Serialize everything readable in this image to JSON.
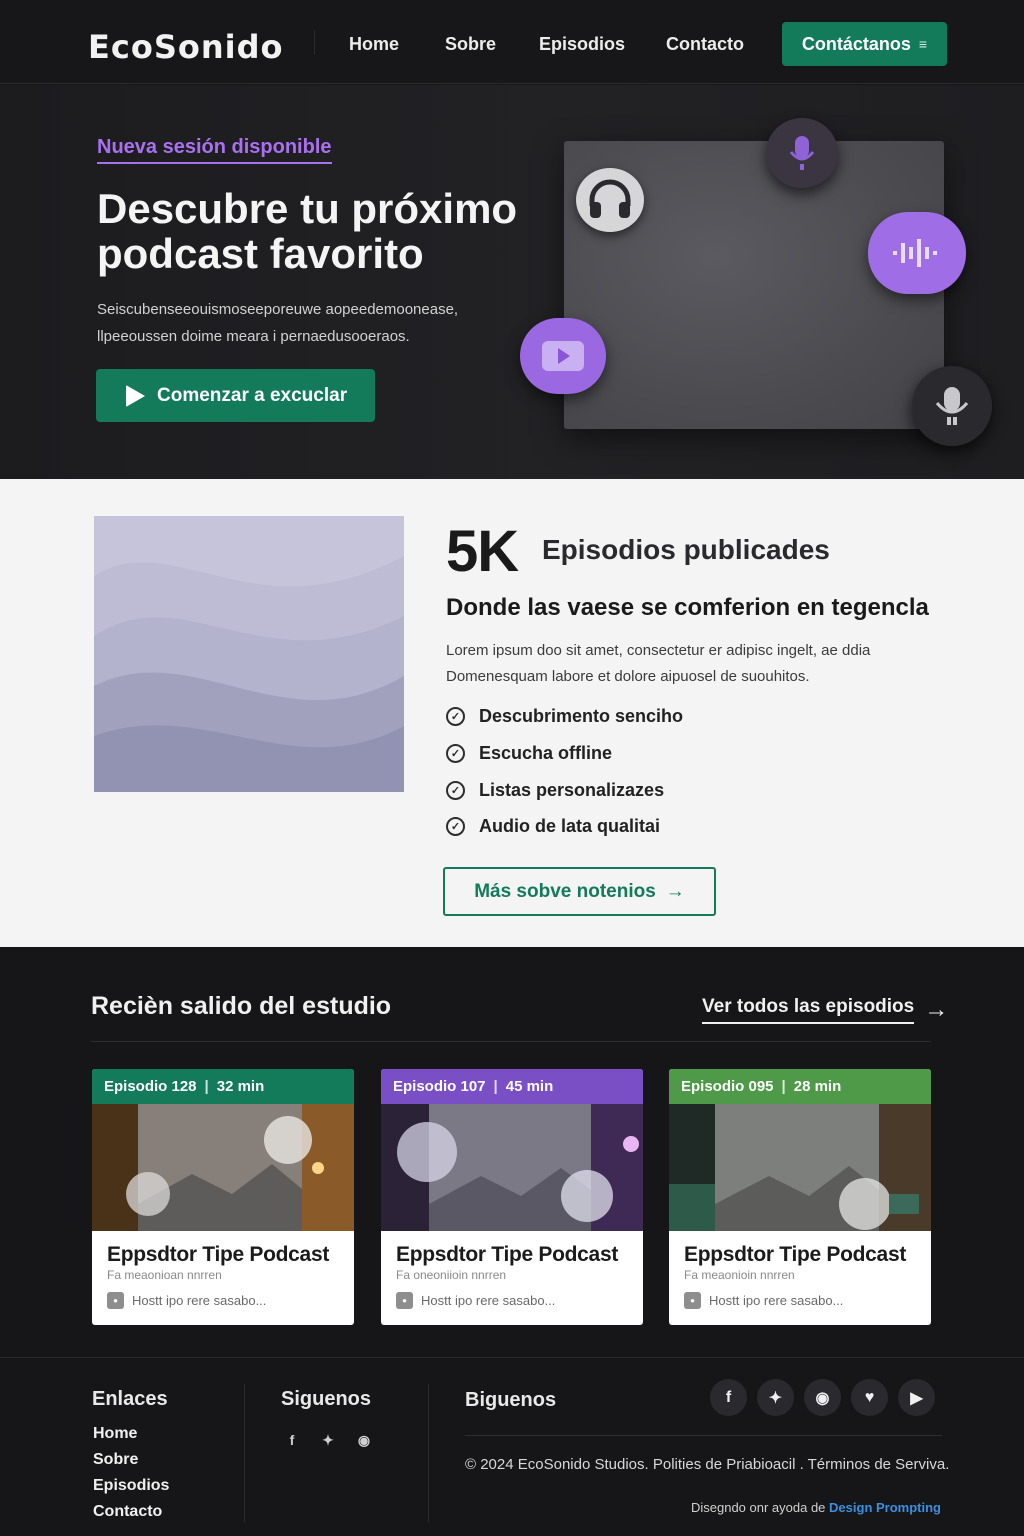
{
  "nav": {
    "logo": "EcoSonido",
    "links": [
      "Home",
      "Sobre",
      "Episodios",
      "Contacto"
    ],
    "cta_label": "Contáctanos"
  },
  "hero": {
    "badge": "Nueva sesión disponible",
    "title": "Descubre tu próximo podcast favorito",
    "subtitle": "Seiscubenseeouismoseeporeuwe aopeedemoonease, llpeeoussen doime meara i pernaedusooeraos.",
    "button_label": "Comenzar a excuclar",
    "icons": [
      "headphones-icon",
      "microphone-icon",
      "audio-wave-icon",
      "play-icon",
      "podcast-mic-icon"
    ],
    "accent": "#a970f0"
  },
  "about": {
    "stat_number": "5K",
    "stat_label": "Episodios publicades",
    "heading": "Donde las vaese se comferion en tegencla",
    "paragraph": "Lorem ipsum doo sit amet, consectetur er adipisc ingelt, ae ddia Domenesquam labore et dolore aipuosel de suouhitos.",
    "features": [
      "Descubrimento senciho",
      "Escucha offline",
      "Listas personalizazes",
      "Audio de lata qualitai"
    ],
    "button_label": "Más sobve notenios"
  },
  "episodes": {
    "title": "Recièn salido del estudio",
    "view_all": "Ver todos las episodios",
    "cards": [
      {
        "episode": "Episodio 128",
        "duration": "32 min",
        "title": "Eppsdtor Tipe Podcast",
        "subtitle": "Fa meaonioan nnrren",
        "host": "Hostt ipo rere sasabo...",
        "color": "#137a5a"
      },
      {
        "episode": "Episodio 107",
        "duration": "45 min",
        "title": "Eppsdtor Tipe Podcast",
        "subtitle": "Fa oneoniioin nnrren",
        "host": "Hostt ipo rere sasabo...",
        "color": "#7a4fc6"
      },
      {
        "episode": "Episodio 095",
        "duration": "28 min",
        "title": "Eppsdtor Tipe Podcast",
        "subtitle": "Fa meaonioin nnrren",
        "host": "Hostt ipo rere sasabo...",
        "color": "#4e9a49"
      }
    ]
  },
  "footer": {
    "links_title": "Enlaces",
    "links": [
      "Home",
      "Sobre",
      "Episodios",
      "Contacto"
    ],
    "follow_title": "Siguenos",
    "follow_title_2": "Biguenos",
    "social_icons": [
      "facebook-icon",
      "twitter-icon",
      "instagram-icon",
      "heart-icon",
      "youtube-icon"
    ],
    "copyright": "© 2024 EcoSonido Studios. Polities de Priabioacil . Términos de Serviva.",
    "credit_prefix": "Disegndo onr ayoda de",
    "credit_link": "Design Prompting"
  }
}
